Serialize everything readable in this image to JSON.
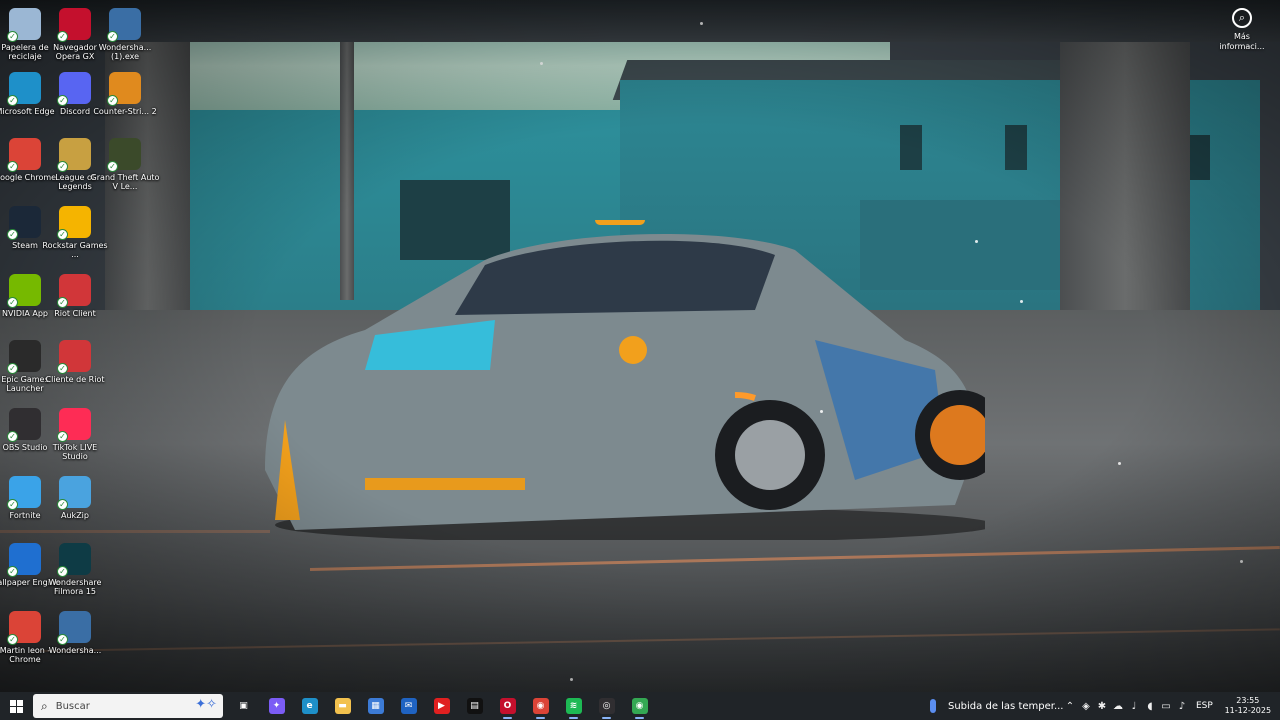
{
  "desktop_icons": [
    {
      "label": "Papelera de reciclaje",
      "icon": "recycle-bin-icon",
      "color": "#9bb7d4"
    },
    {
      "label": "Navegador Opera GX",
      "icon": "opera-gx-icon",
      "color": "#c4102d"
    },
    {
      "label": "Wondersha... (1).exe",
      "icon": "wondershare-icon",
      "color": "#3a6ea5"
    },
    {
      "label": "Microsoft Edge",
      "icon": "edge-icon",
      "color": "#1e90c9"
    },
    {
      "label": "Discord",
      "icon": "discord-icon",
      "color": "#5865f2"
    },
    {
      "label": "Counter-Stri... 2",
      "icon": "counter-strike-icon",
      "color": "#e08a1e"
    },
    {
      "label": "Google Chrome",
      "icon": "chrome-icon",
      "color": "#db4437"
    },
    {
      "label": "League of Legends",
      "icon": "league-of-legends-icon",
      "color": "#c8a041"
    },
    {
      "label": "Grand Theft Auto V Le...",
      "icon": "gta-v-icon",
      "color": "#3b4a2a"
    },
    {
      "label": "Steam",
      "icon": "steam-icon",
      "color": "#1b2838"
    },
    {
      "label": "Rockstar Games ...",
      "icon": "rockstar-icon",
      "color": "#f5b400"
    },
    {
      "label": "NVIDIA App",
      "icon": "nvidia-icon",
      "color": "#76b900"
    },
    {
      "label": "Riot Client",
      "icon": "riot-client-icon",
      "color": "#d13639"
    },
    {
      "label": "Epic Games Launcher",
      "icon": "epic-games-icon",
      "color": "#2a2a2a"
    },
    {
      "label": "Cliente de Riot",
      "icon": "riot-client-icon",
      "color": "#d13639"
    },
    {
      "label": "OBS Studio",
      "icon": "obs-icon",
      "color": "#302e31"
    },
    {
      "label": "TikTok LIVE Studio",
      "icon": "tiktok-icon",
      "color": "#fe2c55"
    },
    {
      "label": "Fortnite",
      "icon": "fortnite-icon",
      "color": "#3aa3e8"
    },
    {
      "label": "AukZip",
      "icon": "aukzip-icon",
      "color": "#4aa3df"
    },
    {
      "label": "Wallpaper Engine",
      "icon": "wallpaper-engine-icon",
      "color": "#1f6fd0"
    },
    {
      "label": "Wondershare Filmora 15",
      "icon": "filmora-icon",
      "color": "#0e3b45"
    },
    {
      "label": "Martin leon - Chrome",
      "icon": "chrome-profile-icon",
      "color": "#db4437"
    },
    {
      "label": "Wondersha...",
      "icon": "wondershare-icon",
      "color": "#3a6ea5"
    }
  ],
  "more_info": {
    "label": "Más informaci..."
  },
  "taskbar": {
    "search_placeholder": "Buscar",
    "apps": [
      {
        "name": "task-view",
        "icon": "task-view-icon",
        "color": "#202428",
        "glyph": "▣",
        "active": false
      },
      {
        "name": "copilot",
        "icon": "copilot-icon",
        "color": "#7b5cf5",
        "glyph": "✦",
        "active": false
      },
      {
        "name": "edge",
        "icon": "edge-icon",
        "color": "#1e90c9",
        "glyph": "e",
        "active": false
      },
      {
        "name": "file-explorer",
        "icon": "folder-icon",
        "color": "#f2c14e",
        "glyph": "▬",
        "active": false
      },
      {
        "name": "microsoft-store",
        "icon": "store-icon",
        "color": "#3c7bd6",
        "glyph": "▦",
        "active": false
      },
      {
        "name": "outlook",
        "icon": "mail-icon",
        "color": "#1f63c2",
        "glyph": "✉",
        "active": false
      },
      {
        "name": "youtube",
        "icon": "youtube-icon",
        "color": "#e02020",
        "glyph": "▶",
        "active": false
      },
      {
        "name": "capcut",
        "icon": "capcut-icon",
        "color": "#111111",
        "glyph": "▤",
        "active": false
      },
      {
        "name": "opera-gx",
        "icon": "opera-gx-icon",
        "color": "#c4102d",
        "glyph": "O",
        "active": true
      },
      {
        "name": "chrome",
        "icon": "chrome-icon",
        "color": "#db4437",
        "glyph": "◉",
        "active": true
      },
      {
        "name": "spotify",
        "icon": "spotify-icon",
        "color": "#1db954",
        "glyph": "≋",
        "active": true
      },
      {
        "name": "obs",
        "icon": "obs-icon",
        "color": "#302e31",
        "glyph": "◎",
        "active": true
      },
      {
        "name": "chrome-profile",
        "icon": "chrome-profile-icon",
        "color": "#34a853",
        "glyph": "◉",
        "active": true
      }
    ],
    "weather_text": "Subida de las temper...",
    "language": "ESP",
    "time": "23:55",
    "date": "11-12-2025"
  }
}
